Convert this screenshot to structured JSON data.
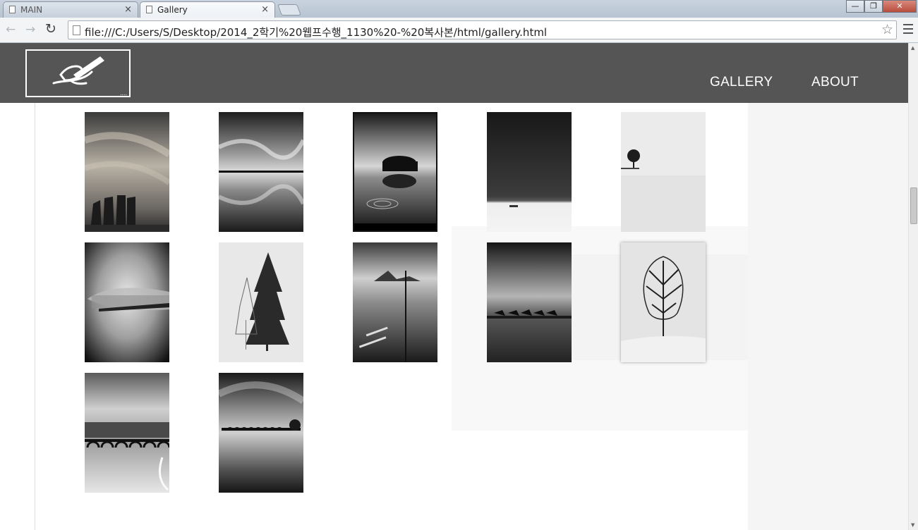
{
  "browser": {
    "tabs": [
      {
        "title": "MAIN",
        "close": "×"
      },
      {
        "title": "Gallery",
        "close": "×"
      }
    ],
    "window_controls": {
      "minimize": "—",
      "restore": "❐",
      "close": "✕"
    },
    "nav": {
      "back": "←",
      "forward": "→",
      "reload": "↻"
    },
    "address": "file:///C:/Users/S/Desktop/2014_2학기%20웹프수행_1130%20-%20복사본/html/gallery.html",
    "star": "☆"
  },
  "site": {
    "logo": {
      "dots": "....",
      "icon": "pen-hand-logo"
    },
    "nav": [
      "GALLERY",
      "ABOUT"
    ],
    "colors": {
      "header": "#555555",
      "nav_text": "#ffffff",
      "page_bg": "#ffffff"
    }
  },
  "gallery": {
    "photos": [
      {
        "subject": "cooling-towers",
        "icon": "photo-icon"
      },
      {
        "subject": "cloud-reflection",
        "icon": "photo-icon"
      },
      {
        "subject": "tree-island-ripples",
        "icon": "photo-icon"
      },
      {
        "subject": "dark-sky-snowfield",
        "icon": "photo-icon"
      },
      {
        "subject": "lone-tree-in-snow",
        "icon": "photo-icon"
      },
      {
        "subject": "misty-tree-line",
        "icon": "photo-icon"
      },
      {
        "subject": "two-trees",
        "icon": "photo-icon"
      },
      {
        "subject": "lake-pole-mountains",
        "icon": "photo-icon"
      },
      {
        "subject": "boats-on-beach",
        "icon": "photo-icon"
      },
      {
        "subject": "winter-tree-framed",
        "icon": "photo-icon"
      },
      {
        "subject": "bridge-city-skyline",
        "icon": "photo-icon"
      },
      {
        "subject": "arched-bridge-lake",
        "icon": "photo-icon"
      }
    ]
  }
}
